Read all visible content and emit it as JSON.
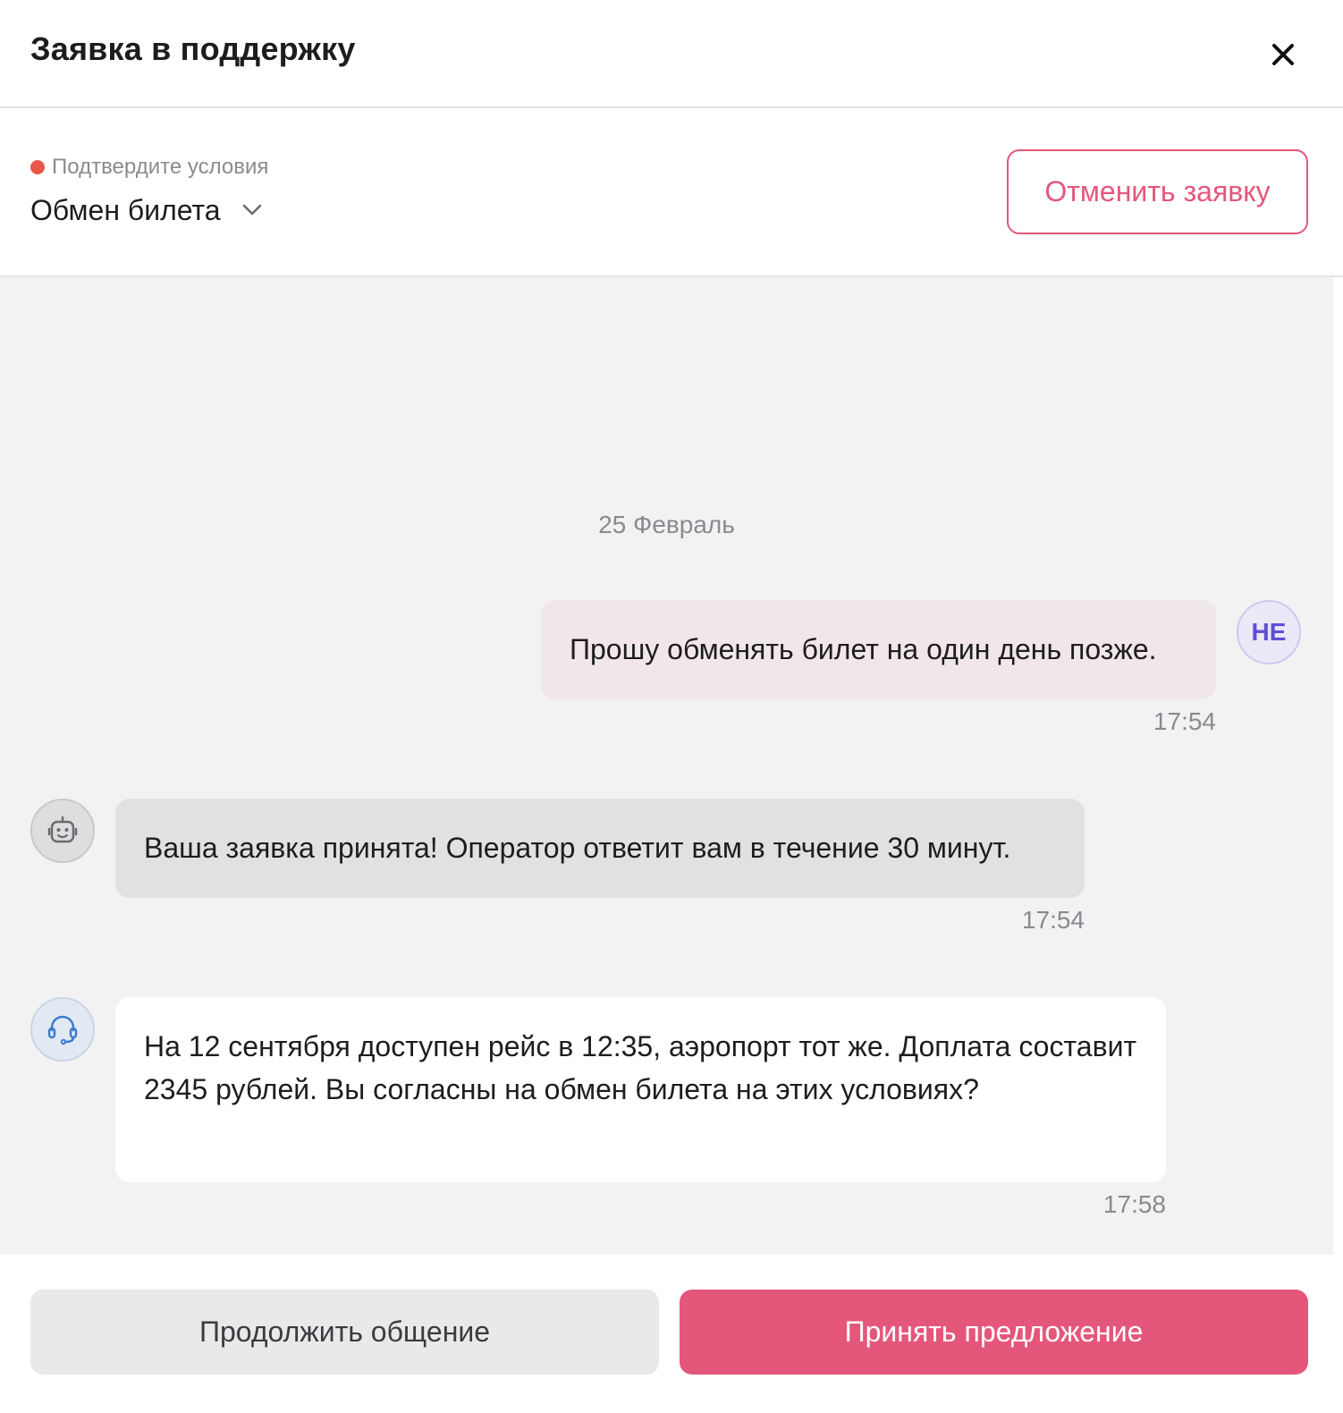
{
  "header": {
    "title": "Заявка в поддержку",
    "close_icon": "close-icon"
  },
  "status": {
    "label": "Подтвердите условия",
    "dot_color": "#e8584a",
    "topic": "Обмен билета",
    "cancel_label": "Отменить заявку"
  },
  "chat": {
    "date": "25 Февраль",
    "messages": [
      {
        "sender": "user",
        "avatar_text": "НЕ",
        "text": "Прошу обменять билет на один день позже.",
        "time": "17:54"
      },
      {
        "sender": "bot",
        "avatar_icon": "robot-icon",
        "text": "Ваша заявка принята! Оператор ответит вам в течение 30 минут.",
        "time": "17:54"
      },
      {
        "sender": "operator",
        "avatar_icon": "headset-icon",
        "text": "На 12 сентября доступен рейс в 12:35, аэропорт тот же. Доплата составит 2345 рублей. Вы согласны на обмен билета на этих условиях?",
        "time": "17:58"
      }
    ]
  },
  "footer": {
    "continue_label": "Продолжить общение",
    "accept_label": "Принять предложение"
  },
  "colors": {
    "accent": "#e4577a",
    "user_bubble": "#f1e6e9",
    "bot_bubble": "#e1e1e4",
    "chat_bg": "#f2f2f3"
  }
}
